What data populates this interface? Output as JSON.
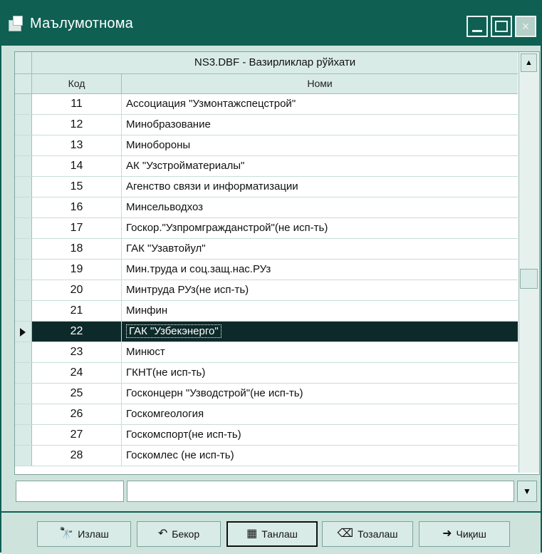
{
  "window": {
    "title": "Маълумотнома"
  },
  "grid": {
    "title": "NS3.DBF - Вазирликлар рўйхати",
    "columns": [
      "Код",
      "Номи"
    ],
    "rows": [
      {
        "code": "11",
        "name": "Ассоциация \"Узмонтажспецстрой\""
      },
      {
        "code": "12",
        "name": "Минобразование"
      },
      {
        "code": "13",
        "name": "Минобороны"
      },
      {
        "code": "14",
        "name": "АК \"Узстройматериалы\""
      },
      {
        "code": "15",
        "name": "Агенство связи и информатизации"
      },
      {
        "code": "16",
        "name": "Минсельводхоз"
      },
      {
        "code": "17",
        "name": "Госкор.\"Узпромгражданстрой\"(не исп-ть)"
      },
      {
        "code": "18",
        "name": "ГАК \"Узавтойул\""
      },
      {
        "code": "19",
        "name": "Мин.труда и соц.защ.нас.РУз"
      },
      {
        "code": "20",
        "name": "Минтруда РУз(не исп-ть)"
      },
      {
        "code": "21",
        "name": "Минфин"
      },
      {
        "code": "22",
        "name": "ГАК \"Узбекэнерго\""
      },
      {
        "code": "23",
        "name": "Минюст"
      },
      {
        "code": "24",
        "name": "ГКНТ(не исп-ть)"
      },
      {
        "code": "25",
        "name": "Госконцерн \"Узводстрой\"(не исп-ть)"
      },
      {
        "code": "26",
        "name": "Госкомгеология"
      },
      {
        "code": "27",
        "name": "Госкомспорт(не исп-ть)"
      },
      {
        "code": "28",
        "name": "Госкомлес (не исп-ть)"
      }
    ],
    "selected_code": "22"
  },
  "buttons": {
    "search": "Излаш",
    "cancel": "Бекор",
    "select": "Танлаш",
    "clear": "Тозалаш",
    "exit": "Чиқиш"
  },
  "colors": {
    "title_bar": "#0f5f53",
    "background": "#cfe3dd",
    "selected_row": "#0d2a2a"
  },
  "icons": {
    "search": "binoculars-icon",
    "cancel": "undo-icon",
    "select": "select-icon",
    "clear": "eraser-icon",
    "exit": "exit-icon"
  }
}
